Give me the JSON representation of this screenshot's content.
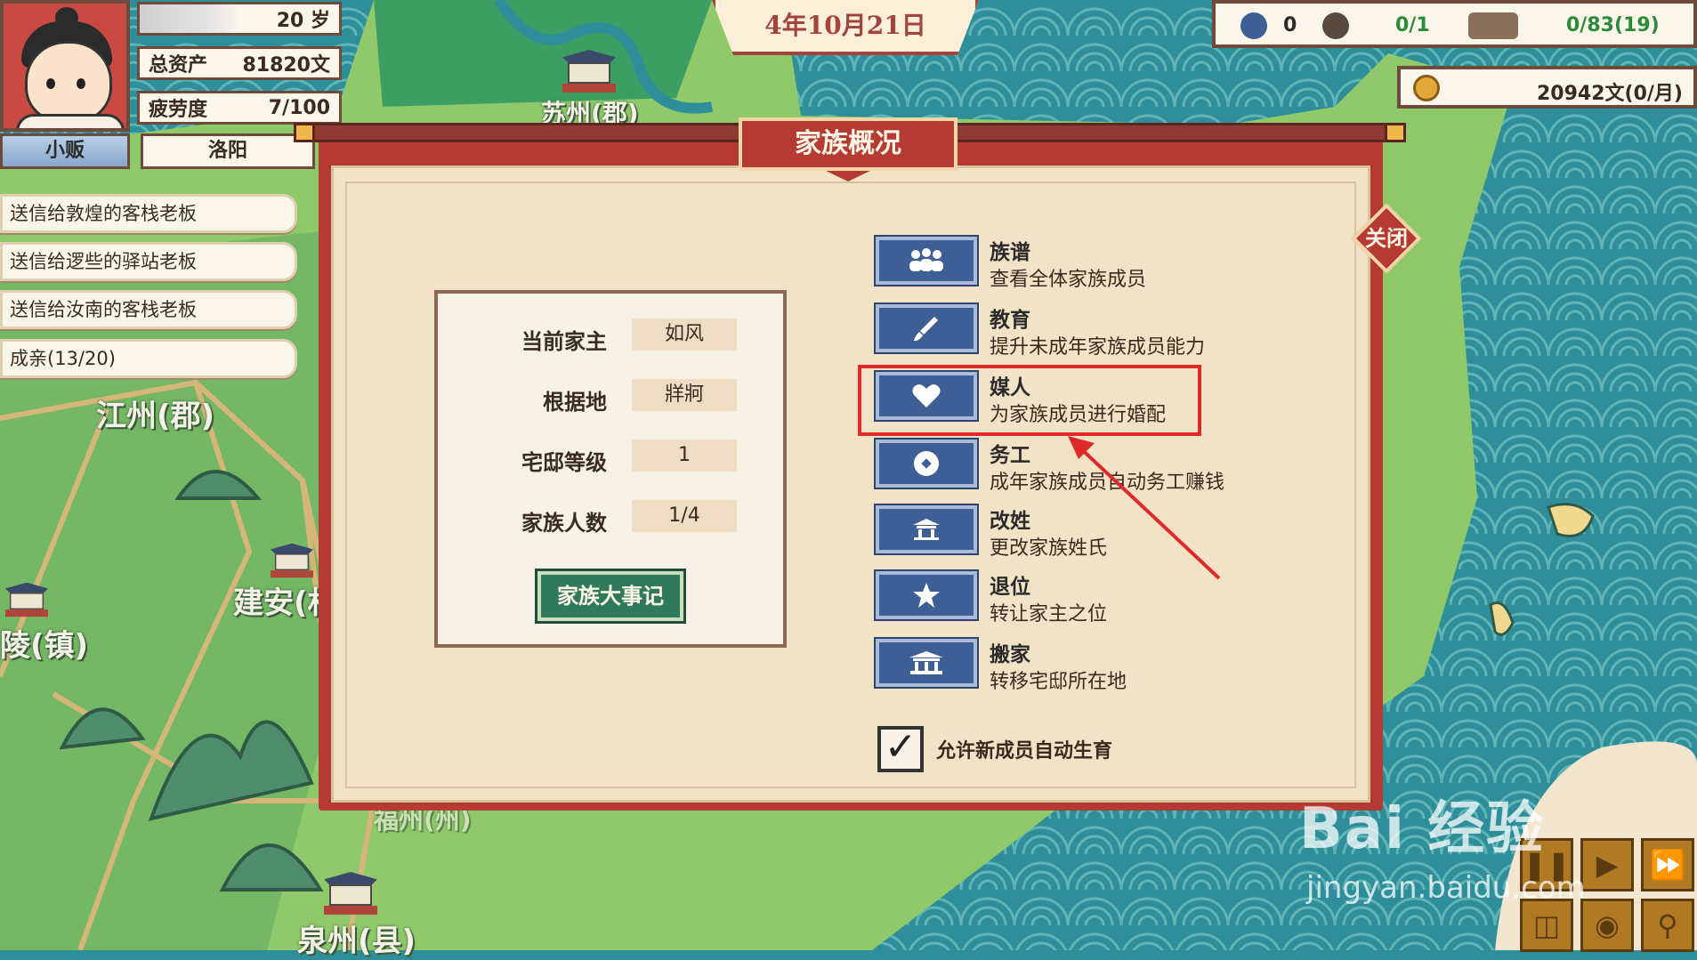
{
  "player": {
    "name": "如风",
    "age": "20 岁",
    "assets_label": "总资产",
    "assets_value": "81820文",
    "fatigue_label": "疲劳度",
    "fatigue_value": "7/100",
    "role": "小贩",
    "location": "洛阳"
  },
  "quests": [
    "送信给敦煌的客栈老板",
    "送信给逻些的驿站老板",
    "送信给汝南的客栈老板",
    "成亲(13/20)"
  ],
  "date": "4年10月21日",
  "resources": {
    "res1_value": "0",
    "res2_value": "0/1",
    "res3_value": "0/83(19)",
    "money": "20942文(0/月)",
    "value_color": "#2d8a3a"
  },
  "map": {
    "cities": [
      "苏州(郡)",
      "江州(郡)",
      "建安(村",
      "陵(镇)",
      "福州(州)",
      "泉州(县)"
    ]
  },
  "dialog": {
    "title": "家族概况",
    "close_label": "关闭",
    "info": [
      {
        "label": "当前家主",
        "value": "如风"
      },
      {
        "label": "根据地",
        "value": "牂牁"
      },
      {
        "label": "宅邸等级",
        "value": "1"
      },
      {
        "label": "家族人数",
        "value": "1/4"
      }
    ],
    "events_button": "家族大事记",
    "menu": [
      {
        "title": "族谱",
        "desc": "查看全体家族成员",
        "icon": "people-icon"
      },
      {
        "title": "教育",
        "desc": "提升未成年家族成员能力",
        "icon": "brush-icon"
      },
      {
        "title": "媒人",
        "desc": "为家族成员进行婚配",
        "icon": "heart-icon"
      },
      {
        "title": "务工",
        "desc": "成年家族成员自动务工赚钱",
        "icon": "coin-icon"
      },
      {
        "title": "改姓",
        "desc": "更改家族姓氏",
        "icon": "house-icon"
      },
      {
        "title": "退位",
        "desc": "转让家主之位",
        "icon": "star-icon"
      },
      {
        "title": "搬家",
        "desc": "转移宅邸所在地",
        "icon": "mansion-icon"
      }
    ],
    "auto_birth_label": "允许新成员自动生育",
    "auto_birth_checked": true
  },
  "watermark": {
    "main": "Bai 经验",
    "sub": "jingyan.baidu.com"
  }
}
